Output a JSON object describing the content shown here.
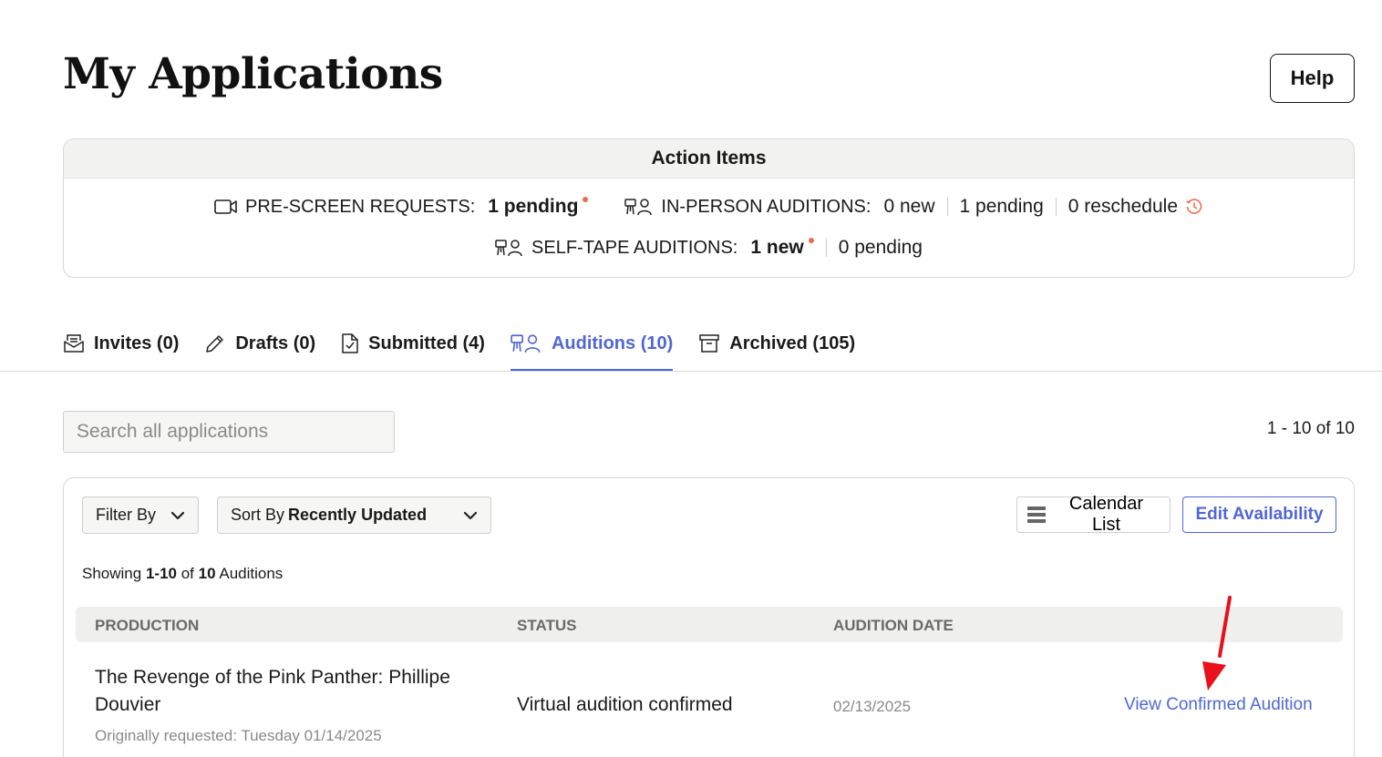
{
  "page": {
    "title": "My Applications",
    "help_label": "Help"
  },
  "action_items": {
    "title": "Action Items",
    "prescreen": {
      "label": "PRE-SCREEN REQUESTS:",
      "pending": "1 pending"
    },
    "in_person": {
      "label": "IN-PERSON AUDITIONS:",
      "new": "0 new",
      "pending": "1 pending",
      "reschedule": "0 reschedule"
    },
    "self_tape": {
      "label": "SELF-TAPE AUDITIONS:",
      "new": "1 new",
      "pending": "0 pending"
    },
    "alert_color": "#ee6b4d"
  },
  "tabs": [
    {
      "label": "Invites (0)",
      "icon": "envelope-icon",
      "active": false
    },
    {
      "label": "Drafts (0)",
      "icon": "pencil-icon",
      "active": false
    },
    {
      "label": "Submitted (4)",
      "icon": "document-check-icon",
      "active": false
    },
    {
      "label": "Auditions (10)",
      "icon": "audition-people-icon",
      "active": true
    },
    {
      "label": "Archived (105)",
      "icon": "archive-box-icon",
      "active": false
    }
  ],
  "search": {
    "placeholder": "Search all applications",
    "value": ""
  },
  "pagination": {
    "range": "1 - 10 of 10"
  },
  "toolbar": {
    "filter_label": "Filter By",
    "sort_prefix": "Sort By",
    "sort_value": "Recently Updated",
    "calendar_label": "Calendar List",
    "edit_label": "Edit Availability"
  },
  "showing": {
    "prefix": "Showing",
    "range": "1-10",
    "of": "of",
    "total": "10",
    "suffix": "Auditions"
  },
  "table": {
    "headers": [
      "PRODUCTION",
      "STATUS",
      "AUDITION DATE"
    ],
    "rows": [
      {
        "production": "The Revenge of the Pink Panther: Phillipe Douvier",
        "requested": "Originally requested: Tuesday 01/14/2025",
        "status": "Virtual audition confirmed",
        "date": "02/13/2025",
        "action": "View Confirmed Audition"
      }
    ]
  },
  "colors": {
    "accent": "#5166d6",
    "annotation_arrow": "#e8101a"
  }
}
